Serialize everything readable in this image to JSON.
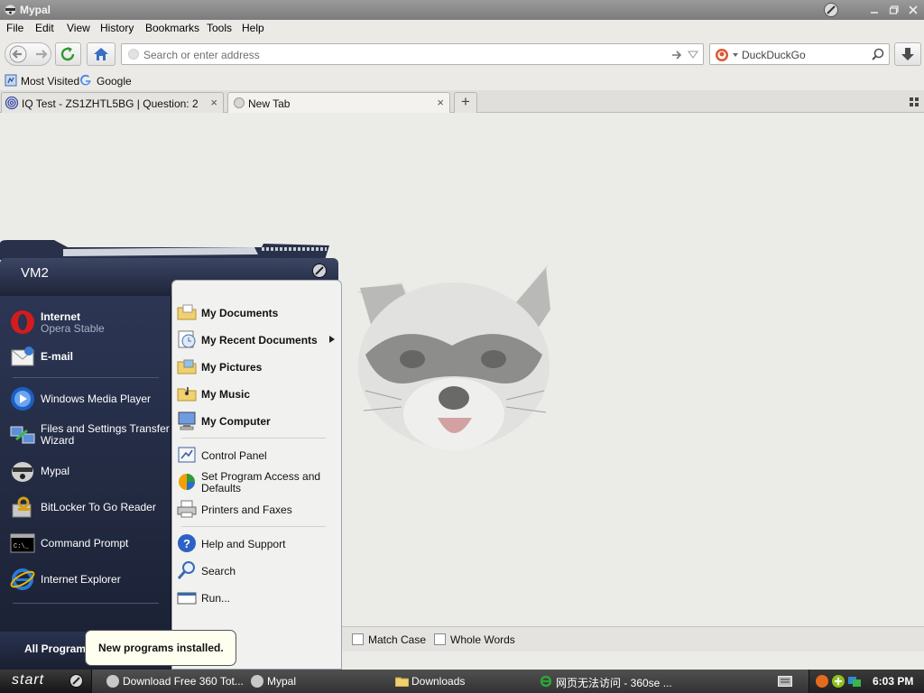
{
  "window": {
    "title": "Mypal",
    "controls": [
      "minimize-icon",
      "maximize-icon",
      "close-icon"
    ]
  },
  "menubar": {
    "items": [
      "File",
      "Edit",
      "View",
      "History",
      "Bookmarks",
      "Tools",
      "Help"
    ]
  },
  "navbar": {
    "url_placeholder": "Search or enter address",
    "search_engine": "DuckDuckGo"
  },
  "bookmarks": {
    "items": [
      "Most Visited",
      "Google"
    ]
  },
  "tabs": [
    {
      "label": "IQ Test - ZS1ZHTL5BG | Question: 2",
      "active": false
    },
    {
      "label": "New Tab",
      "active": true
    }
  ],
  "findbar": {
    "match_case": "Match Case",
    "whole_words": "Whole Words"
  },
  "startmenu": {
    "user": "VM2",
    "pinned": [
      {
        "label": "Internet",
        "sub": "Opera Stable",
        "icon": "opera-icon"
      },
      {
        "label": "E-mail",
        "icon": "email-icon"
      }
    ],
    "recent": [
      {
        "label": "Windows Media Player",
        "icon": "media-player-icon"
      },
      {
        "label": "Files and Settings Transfer",
        "label2": "Wizard",
        "icon": "transfer-wizard-icon"
      },
      {
        "label": "Mypal",
        "icon": "mypal-icon"
      },
      {
        "label": "BitLocker To Go Reader",
        "icon": "bitlocker-icon"
      },
      {
        "label": "Command Prompt",
        "icon": "command-prompt-icon"
      },
      {
        "label": "Internet Explorer",
        "icon": "internet-explorer-icon"
      }
    ],
    "all_programs": "All Programs",
    "right_places": [
      {
        "label": "My Documents",
        "icon": "folder-icon"
      },
      {
        "label": "My Recent Documents",
        "icon": "recent-docs-icon",
        "submenu": true
      },
      {
        "label": "My Pictures",
        "icon": "folder-icon"
      },
      {
        "label": "My Music",
        "icon": "folder-icon"
      },
      {
        "label": "My Computer",
        "icon": "computer-icon"
      }
    ],
    "right_settings": [
      {
        "label": "Control Panel",
        "icon": "control-panel-icon"
      },
      {
        "label": "Set Program Access and",
        "label2": "Defaults",
        "icon": "program-access-icon"
      },
      {
        "label": "Printers and Faxes",
        "icon": "printer-icon"
      }
    ],
    "right_help": [
      {
        "label": "Help and Support",
        "icon": "help-icon"
      },
      {
        "label": "Search",
        "icon": "search-icon"
      },
      {
        "label": "Run...",
        "icon": "run-icon"
      }
    ]
  },
  "tooltip": {
    "text": "New programs installed."
  },
  "taskbar": {
    "start_label": "start",
    "tasks": [
      {
        "label": "Download Free 360 Tot..."
      },
      {
        "label": "Mypal"
      },
      {
        "label": "Downloads"
      },
      {
        "label": "网页无法访问 - 360se ..."
      }
    ],
    "clock": "6:03 PM"
  }
}
